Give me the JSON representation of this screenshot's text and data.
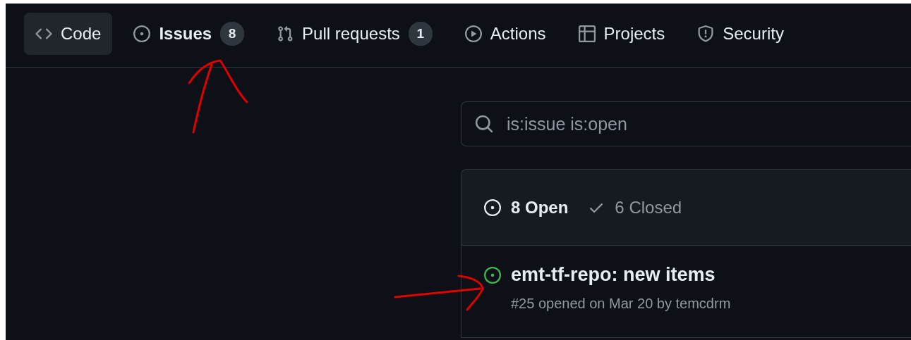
{
  "tabs": [
    {
      "label": "Code",
      "selected": false,
      "hovered": true
    },
    {
      "label": "Issues",
      "counter": "8",
      "selected": true,
      "hovered": false
    },
    {
      "label": "Pull requests",
      "counter": "1",
      "selected": false,
      "hovered": false
    },
    {
      "label": "Actions",
      "selected": false,
      "hovered": false
    },
    {
      "label": "Projects",
      "selected": false,
      "hovered": false
    },
    {
      "label": "Security",
      "selected": false,
      "hovered": false
    }
  ],
  "search": {
    "value": "is:issue is:open"
  },
  "filters": [
    {
      "label": "8 Open",
      "kind": "open",
      "selected": true
    },
    {
      "label": "6 Closed",
      "kind": "closed",
      "selected": false
    }
  ],
  "issues": [
    {
      "title": "emt-tf-repo: new items",
      "meta": "#25 opened on Mar 20 by temcdrm",
      "color": "#3fb950"
    }
  ]
}
